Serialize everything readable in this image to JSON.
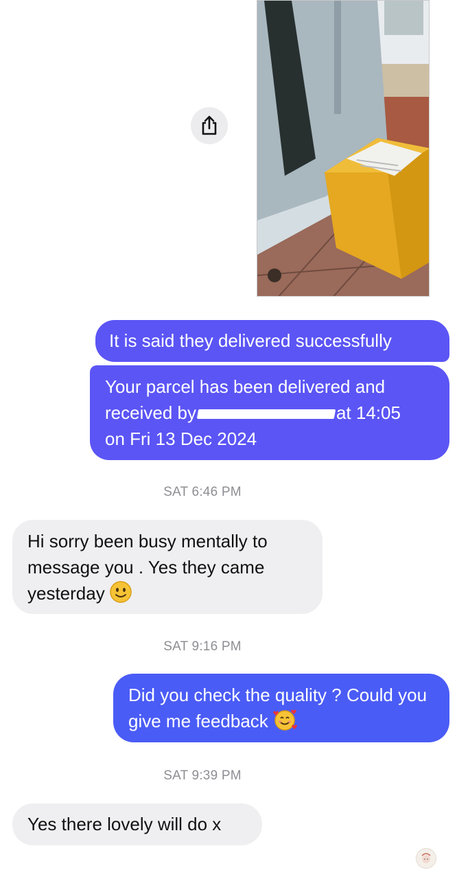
{
  "messages": [
    {
      "sender": "me",
      "text": "It is said they delivered successfully"
    },
    {
      "sender": "me",
      "text_before": "Your parcel has been delivered and received by",
      "text_after": "at 14:05",
      "text_line3": "on Fri 13 Dec 2024"
    },
    {
      "sender": "them",
      "text": "Hi sorry been busy mentally to message you . Yes they came yesterday"
    },
    {
      "sender": "me",
      "text": "Did you check the quality ? Could you give me feedback"
    },
    {
      "sender": "them",
      "text": "Yes there lovely will do x"
    }
  ],
  "timestamps": [
    "SAT 6:46 PM",
    "SAT 9:16 PM",
    "SAT 9:39 PM"
  ],
  "icons": {
    "share": "share-icon",
    "slight_smile": "slightly-smiling-face-icon",
    "smiling_hearts": "smiling-face-with-hearts-icon",
    "seen_avatar": "avatar"
  },
  "colors": {
    "outgoing": "#5b55f5",
    "outgoing_alt": "#4a5cf6",
    "incoming": "#efeff1",
    "timestamp": "#8e8e93"
  }
}
